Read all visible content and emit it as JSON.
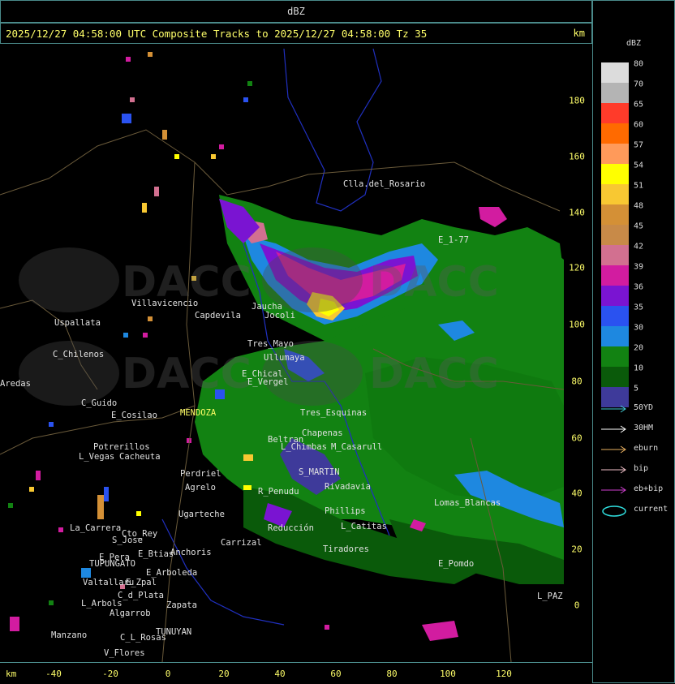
{
  "title": "dBZ",
  "header": {
    "text": "2025/12/27 04:58:00 UTC Composite Tracks to 2025/12/27 04:58:00 Tz 35",
    "km_label": "km"
  },
  "watermark": {
    "text": "DACC"
  },
  "y_axis": {
    "unit": "km",
    "ticks": [
      "180",
      "160",
      "140",
      "120",
      "100",
      "80",
      "60",
      "40",
      "20",
      "0"
    ]
  },
  "x_axis": {
    "unit": "km",
    "ticks": [
      "-40",
      "-20",
      "0",
      "20",
      "40",
      "60",
      "80",
      "100",
      "120"
    ]
  },
  "legend": {
    "title": "dBZ",
    "scale": [
      {
        "label": "80",
        "color": "#dcdcdc"
      },
      {
        "label": "70",
        "color": "#b4b4b4"
      },
      {
        "label": "65",
        "color": "#ff3b2a"
      },
      {
        "label": "60",
        "color": "#ff6a00"
      },
      {
        "label": "57",
        "color": "#ff9a5a"
      },
      {
        "label": "54",
        "color": "#ffff00"
      },
      {
        "label": "51",
        "color": "#f8c832"
      },
      {
        "label": "48",
        "color": "#d49036"
      },
      {
        "label": "45",
        "color": "#c88a48"
      },
      {
        "label": "42",
        "color": "#d27090"
      },
      {
        "label": "39",
        "color": "#d21ca0"
      },
      {
        "label": "36",
        "color": "#7a14d2"
      },
      {
        "label": "35",
        "color": "#2a52f0"
      },
      {
        "label": "30",
        "color": "#1e88e0"
      },
      {
        "label": "20",
        "color": "#128212"
      },
      {
        "label": "10",
        "color": "#0a5a0a"
      },
      {
        "label": "5",
        "color": "#3e3a9a"
      }
    ],
    "tracks": [
      {
        "label": "50YD",
        "color": "#40c8d0"
      },
      {
        "label": "30HM",
        "color": "#ffffff"
      },
      {
        "label": "eburn",
        "color": "#e8b060"
      },
      {
        "label": "bip",
        "color": "#f0c0c8"
      },
      {
        "label": "eb+bip",
        "color": "#d040d0"
      }
    ],
    "current": {
      "label": "current",
      "color": "#30e0e0"
    }
  },
  "places": [
    {
      "name": "Clla.del_Rosario"
    },
    {
      "name": "E_1-77"
    },
    {
      "name": "Villavicencio"
    },
    {
      "name": "Capdevila"
    },
    {
      "name": "Jocoli"
    },
    {
      "name": "Uspallata"
    },
    {
      "name": "C_Chilenos"
    },
    {
      "name": "Tres_Mayo"
    },
    {
      "name": "Ullumaya"
    },
    {
      "name": "E_Chical"
    },
    {
      "name": "E_Vergel"
    },
    {
      "name": "C_Guido"
    },
    {
      "name": "E_Cosilao"
    },
    {
      "name": "MENDOZA"
    },
    {
      "name": "Potrerillos"
    },
    {
      "name": "L_Vegas"
    },
    {
      "name": "Cacheuta"
    },
    {
      "name": "Perdriel"
    },
    {
      "name": "Agrelo"
    },
    {
      "name": "Ugarteche"
    },
    {
      "name": "L_Chimbas"
    },
    {
      "name": "M_Casarull"
    },
    {
      "name": "Chapenas"
    },
    {
      "name": "S_MARTIN"
    },
    {
      "name": "Rivadavia"
    },
    {
      "name": "L_Catitas"
    },
    {
      "name": "Phillips"
    },
    {
      "name": "Lomas_Blancas"
    },
    {
      "name": "La_Carrera"
    },
    {
      "name": "Cto_Rey"
    },
    {
      "name": "S_Jose"
    },
    {
      "name": "E_Pera"
    },
    {
      "name": "TUPUNGATO"
    },
    {
      "name": "E_Btias"
    },
    {
      "name": "Anchoris"
    },
    {
      "name": "Carrizal"
    },
    {
      "name": "E_Arboleda"
    },
    {
      "name": "Tiradores"
    },
    {
      "name": "E_Pomdo"
    },
    {
      "name": "L_PAZ"
    },
    {
      "name": "Valtallaru"
    },
    {
      "name": "E_Zpal"
    },
    {
      "name": "L_Arbols"
    },
    {
      "name": "C_d_Plata"
    },
    {
      "name": "Zapata"
    },
    {
      "name": "Algarrob"
    },
    {
      "name": "Manzano"
    },
    {
      "name": "C_L_Rosas"
    },
    {
      "name": "TUNUYAN"
    },
    {
      "name": "V_Flores"
    },
    {
      "name": "Reducción"
    },
    {
      "name": "Tres_Esquinas"
    },
    {
      "name": "R_Penudu"
    },
    {
      "name": "Aredas"
    },
    {
      "name": "Beltran"
    },
    {
      "name": "Jaucha"
    }
  ]
}
